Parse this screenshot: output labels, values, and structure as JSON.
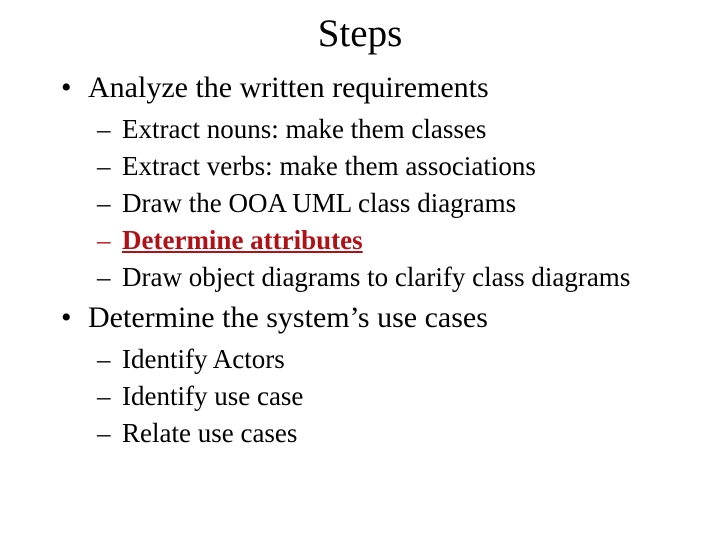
{
  "slide": {
    "title": "Steps",
    "background_color": "#FFFFFF",
    "text_color": "#000000",
    "emphasis_color": "#B01117",
    "bullet_marker": "•",
    "sub_bullet_marker": "–",
    "blocks": [
      {
        "level": 1,
        "marker": "•",
        "text": "Analyze the written requirements",
        "emphasis": false
      },
      {
        "level": 2,
        "marker": "–",
        "text": "Extract nouns: make them classes",
        "emphasis": false
      },
      {
        "level": 2,
        "marker": "–",
        "text": "Extract verbs: make them associations",
        "emphasis": false
      },
      {
        "level": 2,
        "marker": "–",
        "text": "Draw the OOA UML class diagrams",
        "emphasis": false
      },
      {
        "level": 2,
        "marker": "–",
        "text": "Determine attributes",
        "emphasis": true
      },
      {
        "level": 2,
        "marker": "–",
        "text": "Draw object diagrams to clarify class diagrams",
        "emphasis": false
      },
      {
        "level": 1,
        "marker": "•",
        "text": "Determine the system’s use cases",
        "emphasis": false
      },
      {
        "level": 2,
        "marker": "–",
        "text": "Identify Actors",
        "emphasis": false
      },
      {
        "level": 2,
        "marker": "–",
        "text": "Identify use case",
        "emphasis": false
      },
      {
        "level": 2,
        "marker": "–",
        "text": "Relate use cases",
        "emphasis": false
      }
    ]
  }
}
